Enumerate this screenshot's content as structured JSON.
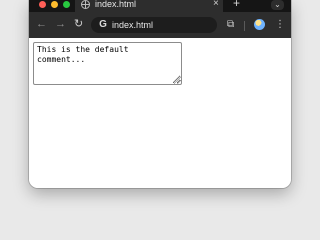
{
  "browser": {
    "tab": {
      "title": "index.html",
      "close_icon": "close-icon",
      "favicon": "globe-icon"
    },
    "new_tab_icon": "plus-icon",
    "tab_search_icon": "chevron-down-icon",
    "address_bar": {
      "url": "index.html",
      "site_icon": "google-icon"
    },
    "nav": {
      "back_icon": "arrow-left-icon",
      "forward_icon": "arrow-right-icon",
      "reload_icon": "reload-icon"
    },
    "toolbar": {
      "extensions_icon": "puzzle-icon",
      "profile_icon": "avatar-icon",
      "menu_icon": "kebab-menu-icon"
    }
  },
  "page": {
    "comment": {
      "value": "This is the default comment..."
    }
  },
  "colors": {
    "tab_strip": "#151515",
    "toolbar": "#2d2d2d",
    "omnibox": "#1d1d1d",
    "close": "#ff5f57",
    "minimize": "#febc2e",
    "maximize": "#28c840"
  }
}
